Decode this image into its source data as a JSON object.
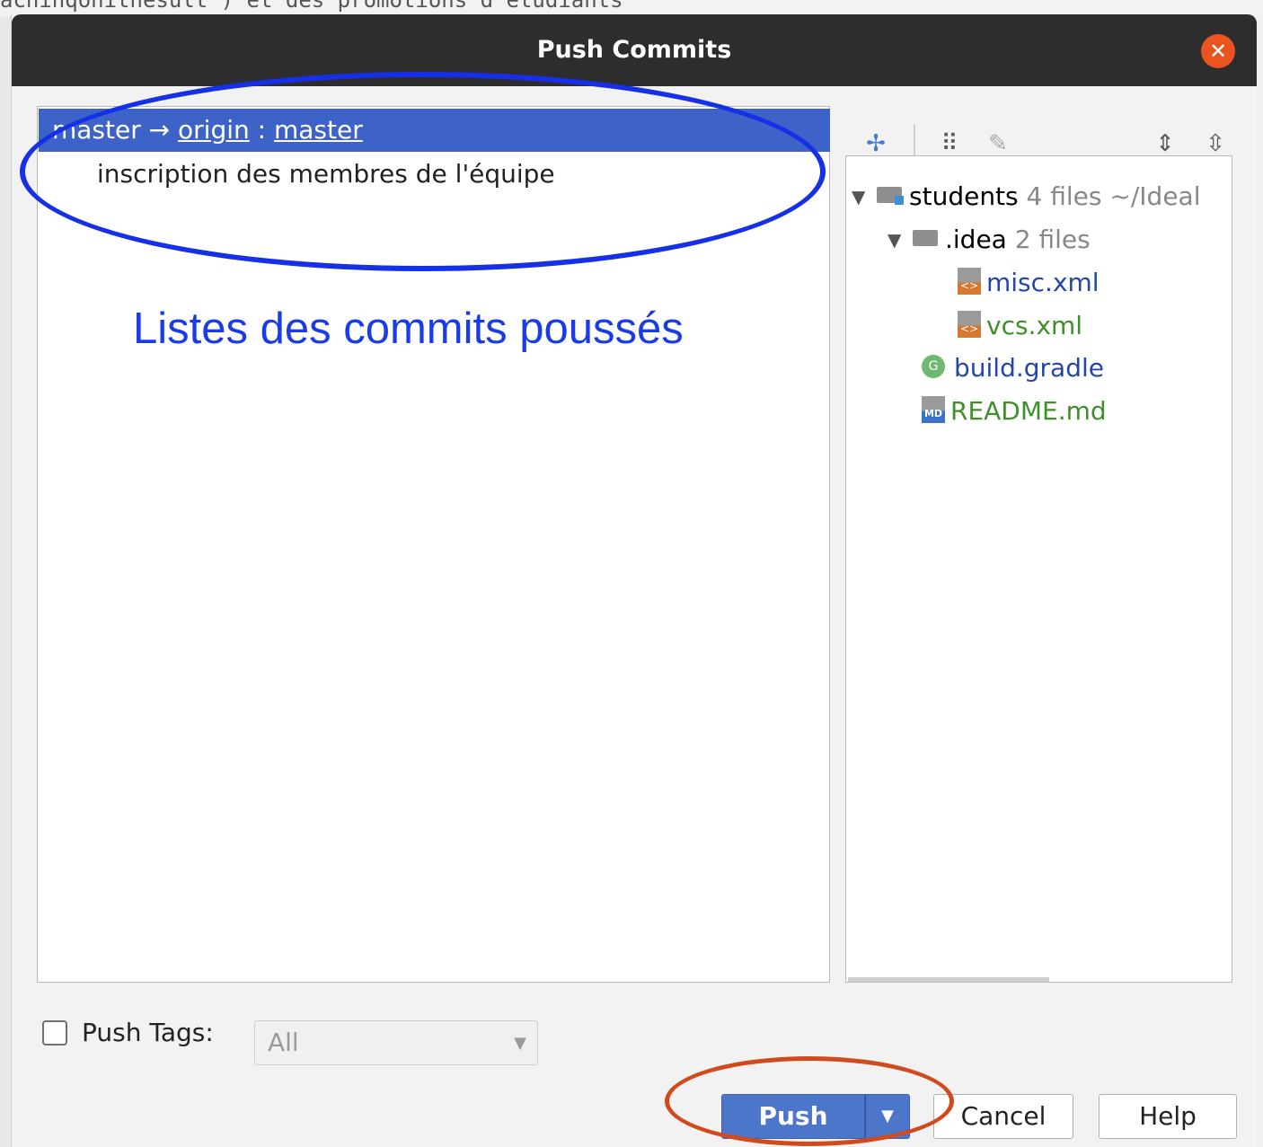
{
  "background": {
    "snippet": "achinqonithesult ) et des promotions d'étudiants"
  },
  "dialog": {
    "title": "Push Commits",
    "close_icon": "close-icon"
  },
  "commits": {
    "branch_local": "master →",
    "remote": "origin",
    "sep": ":",
    "branch_remote": "master",
    "items": [
      {
        "message": "inscription des membres de l'équipe"
      }
    ]
  },
  "annotation": {
    "label": "Listes des commits poussés",
    "color": "#1a3ce8"
  },
  "toolbar": {
    "icons": [
      "sync-icon",
      "group-icon",
      "edit-icon",
      "expand-all-icon",
      "collapse-all-icon"
    ]
  },
  "files": {
    "root": {
      "name": "students",
      "count": "4 files",
      "path": "~/Ideal"
    },
    "folder": {
      "name": ".idea",
      "count": "2 files"
    },
    "children": [
      {
        "name": "misc.xml",
        "status": "modified",
        "color": "#2446a8"
      },
      {
        "name": "vcs.xml",
        "status": "added",
        "color": "#3f8f2b"
      }
    ],
    "others": [
      {
        "name": "build.gradle",
        "status": "modified",
        "color": "#2446a8"
      },
      {
        "name": "README.md",
        "status": "added",
        "color": "#3f8f2b"
      }
    ]
  },
  "push_tags": {
    "label": "Push Tags:",
    "checked": false,
    "value": "All"
  },
  "buttons": {
    "push": "Push",
    "cancel": "Cancel",
    "help": "Help"
  },
  "colors": {
    "accent": "#4b76c9",
    "selection": "#3d63c9",
    "close": "#e95420",
    "annotation_red": "#d14a1e"
  }
}
